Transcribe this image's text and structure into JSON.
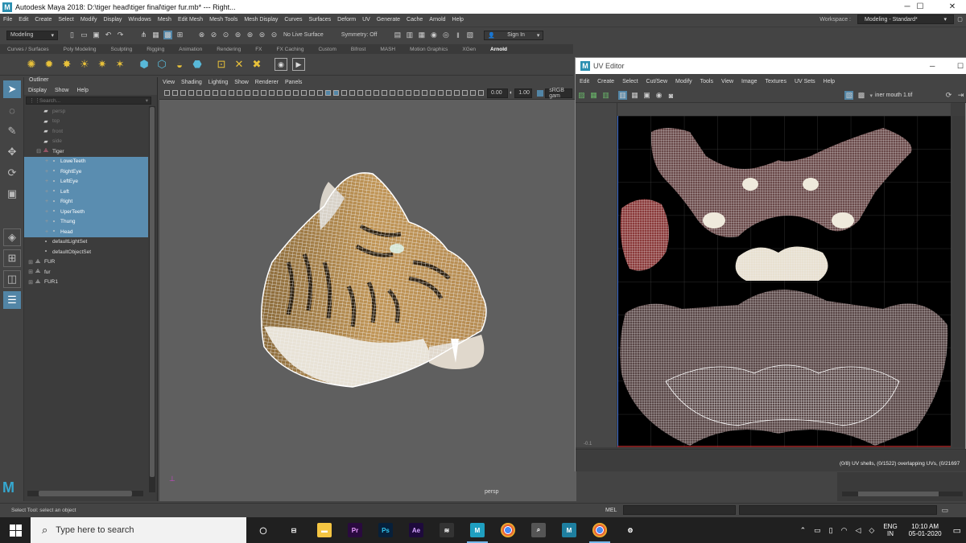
{
  "window": {
    "title": "Autodesk Maya 2018: D:\\tiger head\\tiger final\\tiger fur.mb*   ---   Right...",
    "min": "─",
    "max": "☐",
    "close": "✕"
  },
  "menubar": {
    "items": [
      "File",
      "Edit",
      "Create",
      "Select",
      "Modify",
      "Display",
      "Windows",
      "Mesh",
      "Edit Mesh",
      "Mesh Tools",
      "Mesh Display",
      "Curves",
      "Surfaces",
      "Deform",
      "UV",
      "Generate",
      "Cache",
      "Arnold",
      "Help"
    ],
    "workspace_label": "Workspace :",
    "workspace_value": "Modeling - Standard*"
  },
  "statusline": {
    "mode": "Modeling",
    "live_surface": "No Live Surface",
    "symmetry": "Symmetry: Off",
    "sign_in": "Sign In"
  },
  "shelf_tabs": [
    "Curves / Surfaces",
    "Poly Modeling",
    "Sculpting",
    "Rigging",
    "Animation",
    "Rendering",
    "FX",
    "FX Caching",
    "Custom",
    "Bifrost",
    "MASH",
    "Motion Graphics",
    "XGen",
    "Arnold"
  ],
  "shelf_active": "Arnold",
  "outliner": {
    "title": "Outliner",
    "menu": [
      "Display",
      "Show",
      "Help"
    ],
    "search_placeholder": "Search...",
    "rows": [
      {
        "label": "persp",
        "indent": 1,
        "type": "camera",
        "dim": true,
        "sel": false,
        "exp": ""
      },
      {
        "label": "top",
        "indent": 1,
        "type": "camera",
        "dim": true,
        "sel": false,
        "exp": ""
      },
      {
        "label": "front",
        "indent": 1,
        "type": "camera",
        "dim": true,
        "sel": false,
        "exp": ""
      },
      {
        "label": "side",
        "indent": 1,
        "type": "camera",
        "dim": true,
        "sel": false,
        "exp": ""
      },
      {
        "label": "Tiger",
        "indent": 1,
        "type": "group",
        "dim": false,
        "sel": false,
        "exp": "⊟"
      },
      {
        "label": "LoweTeeth",
        "indent": 2,
        "type": "mesh",
        "dim": false,
        "sel": true,
        "exp": "+"
      },
      {
        "label": "RightEye",
        "indent": 2,
        "type": "mesh",
        "dim": false,
        "sel": true,
        "exp": "+"
      },
      {
        "label": "LeftEye",
        "indent": 2,
        "type": "mesh",
        "dim": false,
        "sel": true,
        "exp": "+"
      },
      {
        "label": "Left",
        "indent": 2,
        "type": "mesh",
        "dim": false,
        "sel": true,
        "exp": "+"
      },
      {
        "label": "Right",
        "indent": 2,
        "type": "mesh",
        "dim": false,
        "sel": true,
        "exp": "+"
      },
      {
        "label": "UperTeeth",
        "indent": 2,
        "type": "mesh",
        "dim": false,
        "sel": true,
        "exp": "+"
      },
      {
        "label": "Thung",
        "indent": 2,
        "type": "mesh",
        "dim": false,
        "sel": true,
        "exp": "+"
      },
      {
        "label": "Head",
        "indent": 2,
        "type": "mesh",
        "dim": false,
        "sel": true,
        "exp": "+"
      },
      {
        "label": "defaultLightSet",
        "indent": 1,
        "type": "set",
        "dim": false,
        "sel": false,
        "exp": ""
      },
      {
        "label": "defaultObjectSet",
        "indent": 1,
        "type": "set",
        "dim": false,
        "sel": false,
        "exp": ""
      },
      {
        "label": "FUR",
        "indent": 0,
        "type": "group",
        "dim": false,
        "sel": false,
        "exp": "⊞"
      },
      {
        "label": "fur",
        "indent": 0,
        "type": "group",
        "dim": false,
        "sel": false,
        "exp": "⊞"
      },
      {
        "label": "FUR1",
        "indent": 0,
        "type": "group",
        "dim": false,
        "sel": false,
        "exp": "⊞"
      }
    ]
  },
  "viewport": {
    "menu": [
      "View",
      "Shading",
      "Lighting",
      "Show",
      "Renderer",
      "Panels"
    ],
    "exposure": "0.00",
    "gamma": "1.00",
    "color_space": "sRGB gam",
    "camera_label": "persp"
  },
  "uv_editor": {
    "title": "UV Editor",
    "menu": [
      "Edit",
      "Create",
      "Select",
      "Cut/Sew",
      "Modify",
      "Tools",
      "View",
      "Image",
      "Textures",
      "UV Sets",
      "Help"
    ],
    "texture": "iner mouth 1.tif",
    "axis_label": "-0.1",
    "status": "(0/8) UV shells, (0/1522) overlapping UVs, (0/21697"
  },
  "command": {
    "left_status": "Select Tool: select an object",
    "mel": "MEL"
  },
  "taskbar": {
    "search_placeholder": "Type here to search",
    "lang": "ENG",
    "region": "IN",
    "time": "10:10 AM",
    "date": "05-01-2020",
    "apps": [
      {
        "name": "task-view",
        "glyph": "◯",
        "bg": "",
        "active": false
      },
      {
        "name": "timeline",
        "glyph": "⊟",
        "bg": "",
        "active": false
      },
      {
        "name": "file-explorer",
        "glyph": "▬",
        "bg": "#f4c542",
        "active": false
      },
      {
        "name": "premiere",
        "glyph": "Pr",
        "bg": "#2a0a3f",
        "active": false
      },
      {
        "name": "photoshop",
        "glyph": "Ps",
        "bg": "#07203a",
        "active": false
      },
      {
        "name": "after-effects",
        "glyph": "Ae",
        "bg": "#1e0a3c",
        "active": false
      },
      {
        "name": "maya-tool",
        "glyph": "≋",
        "bg": "#333",
        "active": false
      },
      {
        "name": "maya",
        "glyph": "M",
        "bg": "#1f9fc0",
        "active": true
      },
      {
        "name": "chrome",
        "glyph": "●",
        "bg": "",
        "active": false
      },
      {
        "name": "inspector",
        "glyph": "⌕",
        "bg": "#555",
        "active": false
      },
      {
        "name": "maya-2",
        "glyph": "M",
        "bg": "#1e7fa0",
        "active": false
      },
      {
        "name": "chrome-2",
        "glyph": "●",
        "bg": "",
        "active": true
      },
      {
        "name": "settings",
        "glyph": "⚙",
        "bg": "",
        "active": false
      }
    ]
  }
}
